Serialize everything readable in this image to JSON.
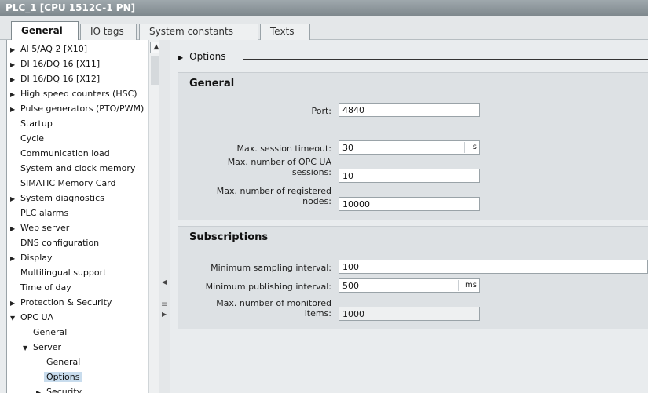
{
  "window": {
    "title": "PLC_1 [CPU 1512C-1 PN]"
  },
  "tabs": [
    {
      "label": "General",
      "active": true
    },
    {
      "label": "IO tags",
      "active": false
    },
    {
      "label": "System constants",
      "active": false
    },
    {
      "label": "Texts",
      "active": false
    }
  ],
  "tree": [
    {
      "label": "AI 5/AQ 2 [X10]",
      "icon": "triangle-right-icon"
    },
    {
      "label": "DI 16/DQ 16 [X11]",
      "icon": "triangle-right-icon"
    },
    {
      "label": "DI 16/DQ 16 [X12]",
      "icon": "triangle-right-icon"
    },
    {
      "label": "High speed counters (HSC)",
      "icon": "triangle-right-icon"
    },
    {
      "label": "Pulse generators (PTO/PWM)",
      "icon": "triangle-right-icon"
    },
    {
      "label": "Startup"
    },
    {
      "label": "Cycle"
    },
    {
      "label": "Communication load"
    },
    {
      "label": "System and clock memory"
    },
    {
      "label": "SIMATIC Memory Card"
    },
    {
      "label": "System diagnostics",
      "icon": "triangle-right-icon"
    },
    {
      "label": "PLC alarms"
    },
    {
      "label": "Web server",
      "icon": "triangle-right-icon"
    },
    {
      "label": "DNS configuration"
    },
    {
      "label": "Display",
      "icon": "triangle-right-icon"
    },
    {
      "label": "Multilingual support"
    },
    {
      "label": "Time of day"
    },
    {
      "label": "Protection & Security",
      "icon": "triangle-right-icon"
    },
    {
      "label": "OPC UA",
      "icon": "triangle-down-icon"
    },
    {
      "label": "General"
    },
    {
      "label": "Server",
      "icon": "triangle-down-icon"
    },
    {
      "label": "General"
    },
    {
      "label": "Options",
      "selected": true
    },
    {
      "label": "Security",
      "icon": "triangle-right-icon"
    }
  ],
  "breadcrumb": {
    "label": "Options"
  },
  "general": {
    "title": "General",
    "port_label": "Port:",
    "port_value": "4840",
    "session_timeout_label": "Max. session timeout:",
    "session_timeout_value": "30",
    "session_timeout_unit": "s",
    "max_sessions_label_1": "Max. number of OPC UA",
    "max_sessions_label_2": "sessions:",
    "max_sessions_value": "10",
    "max_nodes_label_1": "Max. number of registered",
    "max_nodes_label_2": "nodes:",
    "max_nodes_value": "10000"
  },
  "subscriptions": {
    "title": "Subscriptions",
    "min_sampling_label": "Minimum sampling interval:",
    "min_sampling_value": "100",
    "min_publishing_label": "Minimum publishing interval:",
    "min_publishing_value": "500",
    "min_publishing_unit": "ms",
    "max_items_label_1": "Max. number of monitored",
    "max_items_label_2": "items:",
    "max_items_value": "1000"
  }
}
